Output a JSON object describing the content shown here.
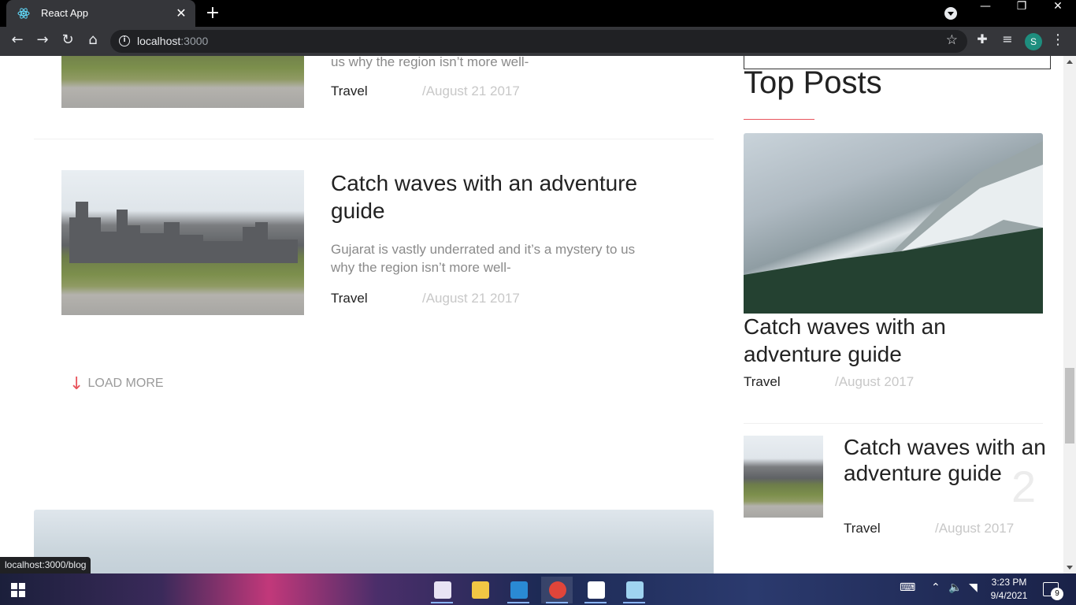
{
  "browser": {
    "tab_title": "React App",
    "tab_close": "✕",
    "new_tab": "+",
    "url_host": "localhost",
    "url_port": ":3000",
    "profile_initial": "S",
    "window_controls": {
      "minimize": "—",
      "restore": "❐",
      "close": "✕"
    },
    "status_url": "localhost:3000/blog"
  },
  "main": {
    "prev_post": {
      "excerpt_tail": "us why the region isn’t more well-",
      "category": "Travel",
      "date": "/August 21 2017"
    },
    "post": {
      "title": "Catch waves with an adventure guide",
      "excerpt": "Gujarat is vastly underrated and it’s a mystery to us why the region isn’t more well-",
      "category": "Travel",
      "date": "/August 21 2017"
    },
    "load_more": {
      "arrow": "↓",
      "label": "LOAD MORE"
    }
  },
  "sidebar": {
    "heading": "Top Posts",
    "accent_color": "#e8545c",
    "featured": {
      "title": "Catch waves with an adventure guide",
      "category": "Travel",
      "date": "/August 2017"
    },
    "list_item": {
      "title": "Catch waves with an adventure guide",
      "number": "2",
      "category": "Travel",
      "date": "/August 2017"
    }
  },
  "taskbar": {
    "clock_time": "3:23 PM",
    "clock_date": "9/4/2021",
    "notification_count": "9"
  }
}
